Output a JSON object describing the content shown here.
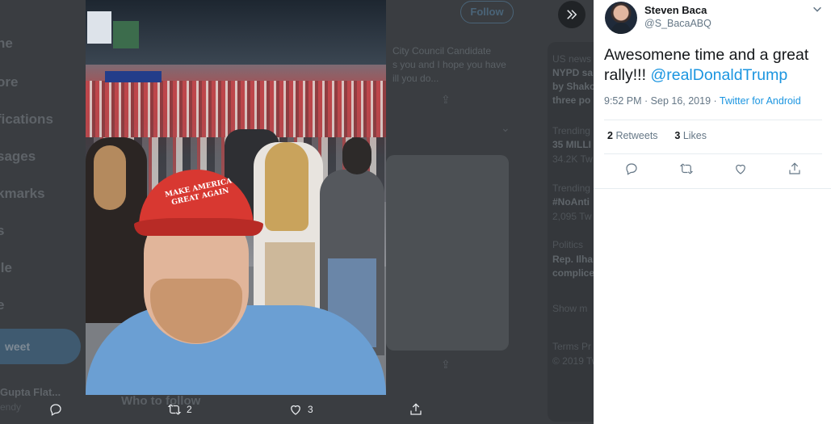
{
  "background": {
    "nav_items": [
      "ne",
      "ore",
      "fications",
      "sages",
      "kmarks",
      "s",
      "ile",
      "e"
    ],
    "tweet_button": "weet",
    "account_name": "Gupta Flat...",
    "account_handle": "endy",
    "follow_button": "Follow",
    "feed_lines": [
      "City Council Candidate",
      "s you and I hope you have",
      "ill you do..."
    ],
    "who_to_follow": "Who to follow",
    "trends": [
      {
        "meta": "US news",
        "title": "NYPD sa"
      },
      {
        "meta": "",
        "title": "by Shako"
      },
      {
        "meta": "",
        "title": "three po"
      },
      {
        "meta": "Trending",
        "title": "35 MILLI"
      },
      {
        "meta": "34.2K Tw",
        "title": ""
      },
      {
        "meta": "Trending",
        "title": "#NoAnti"
      },
      {
        "meta": "2,095 Tw",
        "title": ""
      },
      {
        "meta": "Politics",
        "title": "Rep. Ilha"
      },
      {
        "meta": "",
        "title": "complice"
      },
      {
        "meta": "Show m",
        "title": ""
      },
      {
        "meta": "Terms  Pr",
        "title": ""
      },
      {
        "meta": "© 2019 Tw",
        "title": ""
      }
    ]
  },
  "photo": {
    "cap_text": "MAKE AMERICA GREAT AGAIN"
  },
  "photo_actions": {
    "retweets": "2",
    "likes": "3"
  },
  "tweet": {
    "name": "Steven Baca",
    "handle": "@S_BacaABQ",
    "text_prefix": "Awesomene time and a great rally!!! ",
    "mention": "@realDonaldTrump",
    "time": "9:52 PM · Sep 16, 2019 · ",
    "source": "Twitter for Android",
    "retweet_count": "2",
    "retweet_label": "Retweets",
    "like_count": "3",
    "like_label": "Likes"
  },
  "colors": {
    "accent": "#1b95e0",
    "muted": "#657786",
    "cap_red": "#d83831"
  }
}
